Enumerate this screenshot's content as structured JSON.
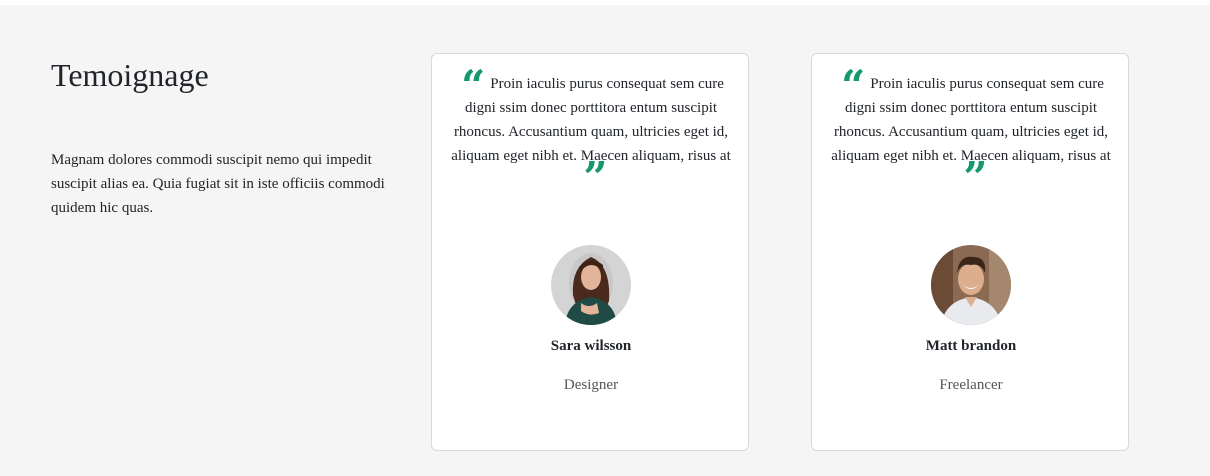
{
  "intro": {
    "title": "Temoignage",
    "text": "Magnam dolores commodi suscipit nemo qui impedit suscipit alias ea. Quia fugiat sit in iste officiis commodi quidem hic quas."
  },
  "accent_color": "#16986e",
  "testimonials": [
    {
      "quote_open_icon": "quote-open-icon",
      "quote_close_icon": "quote-close-icon",
      "quote": "Proin iaculis purus consequat sem cure digni ssim donec porttitora entum suscipit rhoncus. Accusantium quam, ultricies eget id, aliquam eget nibh et. Maecen aliquam, risus at",
      "name": "Sara wilsson",
      "role": "Designer",
      "avatar": "woman-avatar"
    },
    {
      "quote_open_icon": "quote-open-icon",
      "quote_close_icon": "quote-close-icon",
      "quote": "Proin iaculis purus consequat sem cure digni ssim donec porttitora entum suscipit rhoncus. Accusantium quam, ultricies eget id, aliquam eget nibh et. Maecen aliquam, risus at",
      "name": "Matt brandon",
      "role": "Freelancer",
      "avatar": "man-avatar"
    }
  ]
}
